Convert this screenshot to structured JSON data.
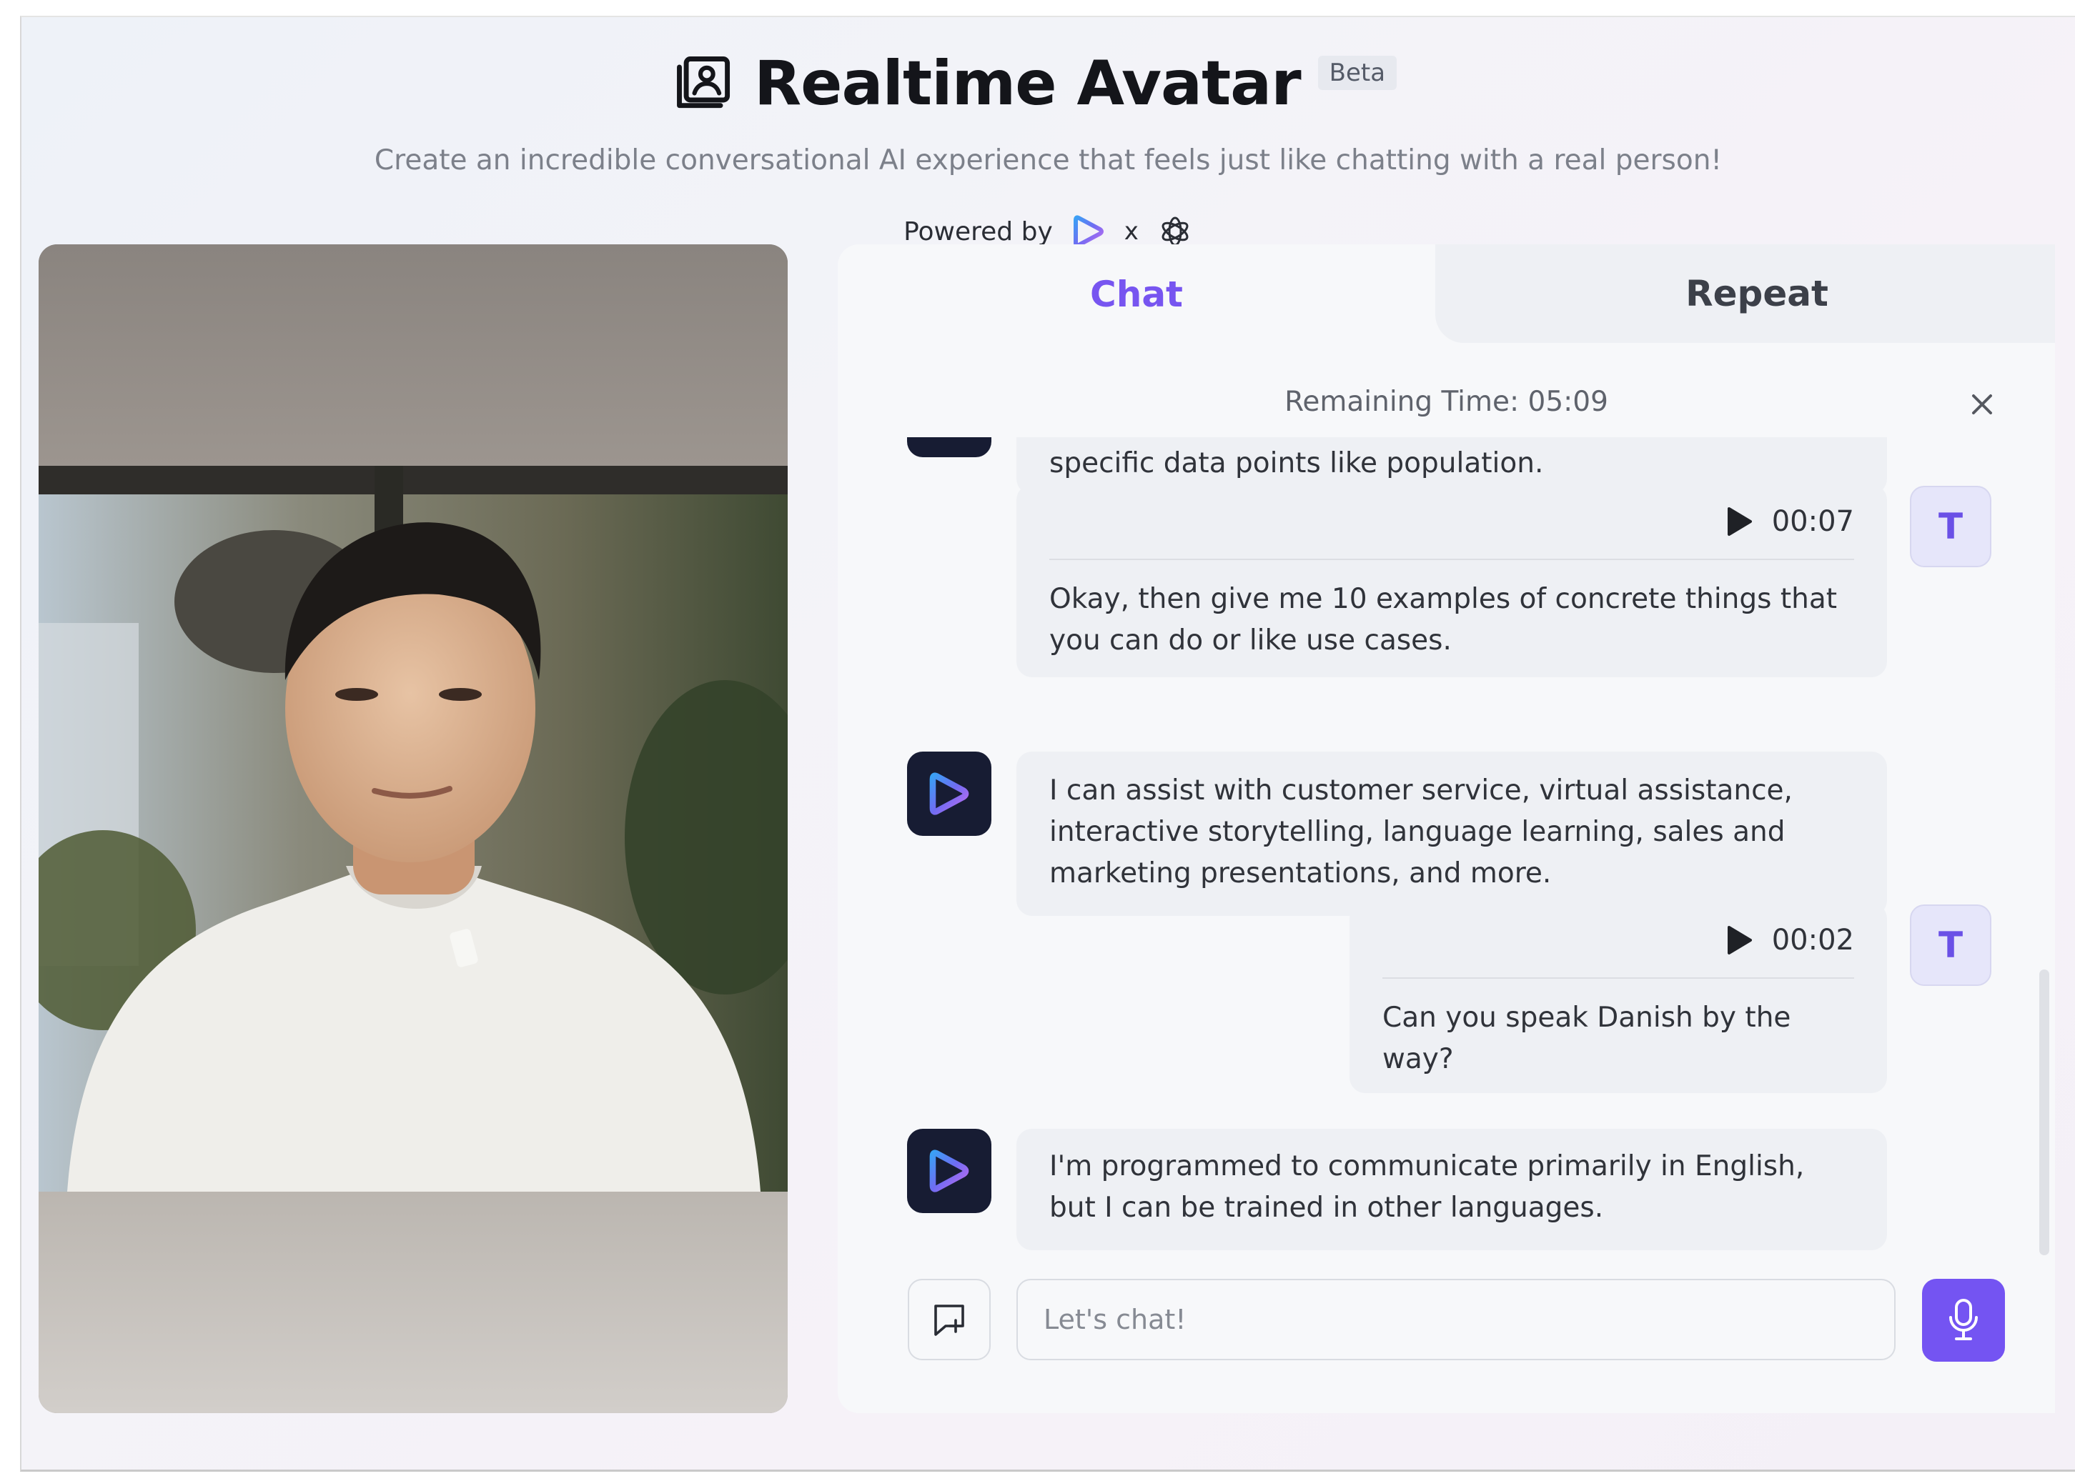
{
  "header": {
    "title": "Realtime Avatar",
    "badge": "Beta",
    "subtitle": "Create an incredible conversational AI experience that feels just like chatting with a real person!",
    "powered_by": "Powered by",
    "powered_sep": "x"
  },
  "tabs": [
    {
      "label": "Chat",
      "active": true
    },
    {
      "label": "Repeat",
      "active": false
    }
  ],
  "chat": {
    "remaining_time": "Remaining Time: 05:09",
    "messages": [
      {
        "role": "ai",
        "text": "specific data points like population."
      },
      {
        "role": "user",
        "avatar": "T",
        "duration": "00:07",
        "text": "Okay, then give me 10 examples of concrete things that you can do or like use cases."
      },
      {
        "role": "ai",
        "text": "I can assist with customer service, virtual assistance, interactive storytelling, language learning, sales and marketing presentations, and more."
      },
      {
        "role": "user",
        "avatar": "T",
        "duration": "00:02",
        "text": "Can you speak Danish by the way?"
      },
      {
        "role": "ai",
        "text": "I'm programmed to communicate primarily in English, but I can be trained in other languages."
      }
    ],
    "input_placeholder": "Let's chat!"
  },
  "colors": {
    "accent": "#7454f2",
    "active_tab": "#7755f0",
    "ai_avatar_bg": "#171c33",
    "user_avatar_bg": "#e6e6fa"
  },
  "icons": {
    "title": "portrait-icon",
    "brand": "play-logo-icon",
    "openai": "openai-logo-icon",
    "close": "close-icon",
    "play": "play-icon",
    "new_chat": "new-chat-icon",
    "mic": "microphone-icon"
  }
}
